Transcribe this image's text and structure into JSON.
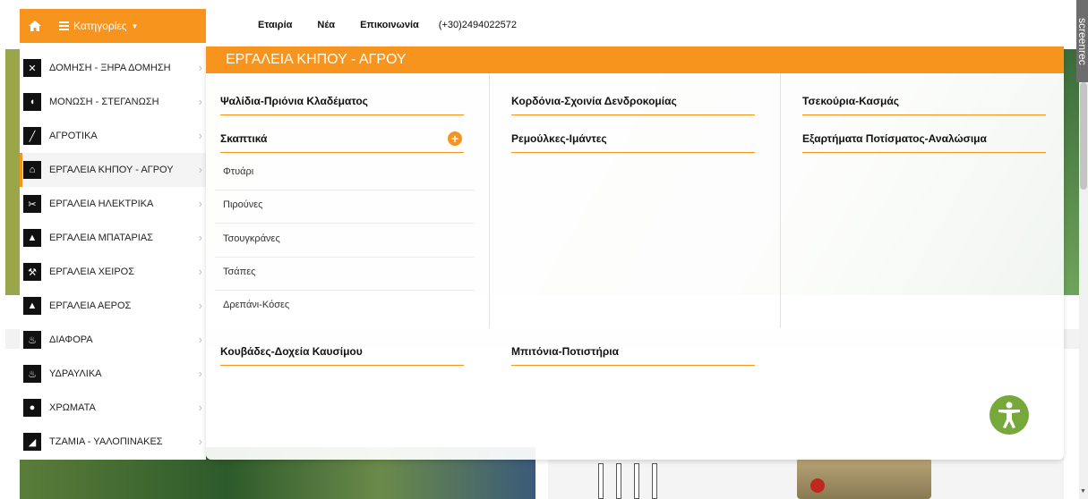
{
  "topbar": {
    "categories_label": "Κατηγορίες",
    "links": [
      "Εταιρία",
      "Νέα",
      "Επικοινωνία"
    ],
    "phone": "(+30)2494022572"
  },
  "sidebar": {
    "items": [
      {
        "label": "ΔΟΜΗΣΗ - ΞΗΡΑ ΔΟΜΗΣΗ",
        "icon": "tools-icon"
      },
      {
        "label": "ΜΟΝΩΣΗ - ΣΤΕΓΑΝΩΣΗ",
        "icon": "insulation-roll-icon"
      },
      {
        "label": "ΑΓΡΟΤΙΚΑ",
        "icon": "scythe-icon"
      },
      {
        "label": "ΕΡΓΑΛΕΙΑ ΚΗΠΟΥ - ΑΓΡΟΥ",
        "icon": "house-icon"
      },
      {
        "label": "ΕΡΓΑΛΕΙΑ ΗΛΕΚΤΡΙΚΑ",
        "icon": "scissors-icon"
      },
      {
        "label": "ΕΡΓΑΛΕΙΑ ΜΠΑΤΑΡΙΑΣ",
        "icon": "battery-tool-icon"
      },
      {
        "label": "ΕΡΓΑΛΕΙΑ ΧΕΙΡΟΣ",
        "icon": "hand-tool-icon"
      },
      {
        "label": "ΕΡΓΑΛΕΙΑ ΑΕΡΟΣ",
        "icon": "air-tool-icon"
      },
      {
        "label": "ΔΙΑΦΟΡΑ",
        "icon": "flame-icon"
      },
      {
        "label": "ΥΔΡΑΥΛΙΚΑ",
        "icon": "flame-icon"
      },
      {
        "label": "ΧΡΩΜΑΤΑ",
        "icon": "paint-drop-icon"
      },
      {
        "label": "ΤΖΑΜΙΑ - ΥΑΛΟΠΙΝΑΚΕΣ",
        "icon": "glass-icon"
      }
    ],
    "active_index": 3
  },
  "mega": {
    "title": "ΕΡΓΑΛΕΙΑ ΚΗΠΟΥ - ΑΓΡΟΥ",
    "col1": {
      "titles": [
        "Ψαλίδια-Πριόνια Κλαδέματος",
        "Σκαπτικά"
      ],
      "subitems": [
        "Φτυάρι",
        "Πιρούνες",
        "Τσουγκράνες",
        "Τσάπες",
        "Δρεπάνι-Κόσες"
      ],
      "bottom_title": "Κουβάδες-Δοχεία Καυσίμου"
    },
    "col2": {
      "titles": [
        "Κορδόνια-Σχοινία Δενδροκομίας",
        "Ρεμούλκες-Ιμάντες"
      ],
      "bottom_title": "Μπιτόνια-Ποτιστήρια"
    },
    "col3": {
      "titles": [
        "Τσεκούρια-Κασμάς",
        "Εξαρτήματα Ποτίσματος-Αναλώσιμα"
      ]
    }
  },
  "watermark": "screenrec",
  "colors": {
    "accent": "#f7941d",
    "accessibility": "#77a93a"
  }
}
